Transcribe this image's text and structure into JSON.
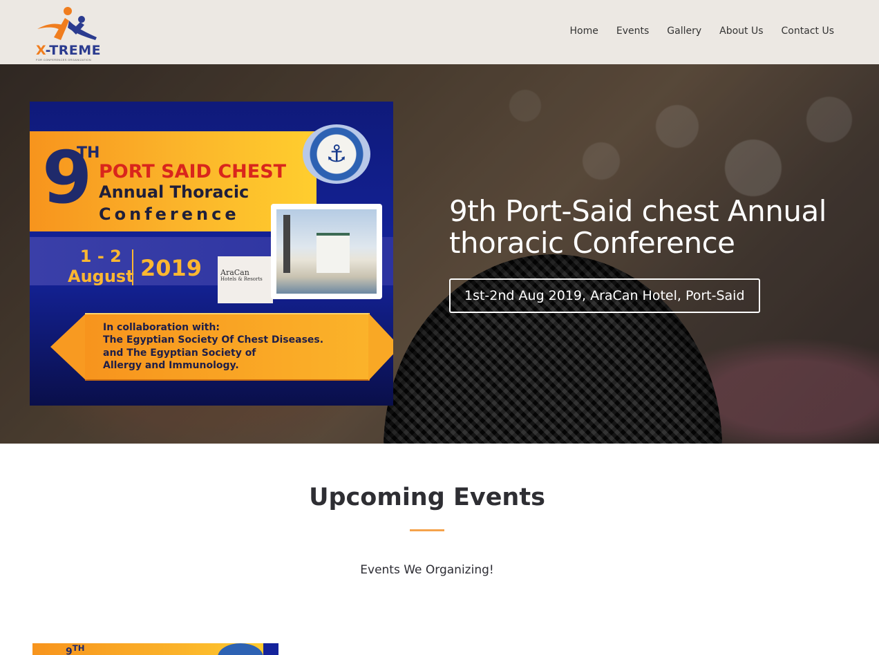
{
  "header": {
    "logo_text_x": "X",
    "logo_text_rest": "-TREME",
    "logo_subtitle": "FOR CONFERENCES ORGANIZATION",
    "nav": [
      "Home",
      "Events",
      "Gallery",
      "About Us",
      "Contact Us"
    ]
  },
  "hero": {
    "title": "9th Port-Said chest Annual thoracic Conference",
    "badge": "1st-2nd Aug 2019, AraCan Hotel, Port-Said",
    "poster": {
      "number": "9",
      "suffix": "TH",
      "line1": "PORT SAID CHEST",
      "line2": "Annual Thoracic",
      "line3": "Conference",
      "dates": "1 - 2",
      "month": "August",
      "year": "2019",
      "hotel_name": "AraCan",
      "hotel_sub": "Hotels & Resorts",
      "collab": "In collaboration with:\nThe Egyptian Society Of Chest Diseases.\nand The Egyptian Society of\nAllergy and Immunology.",
      "seal_icon": "anchor-icon"
    }
  },
  "upcoming": {
    "title": "Upcoming Events",
    "subtitle": "Events We Organizing!",
    "thumb_number": "9",
    "thumb_suffix": "TH"
  },
  "colors": {
    "accent": "#f5a24b",
    "header_bg": "#ece8e3",
    "brand_blue": "#2b3b8f",
    "brand_orange": "#f07d1e"
  }
}
